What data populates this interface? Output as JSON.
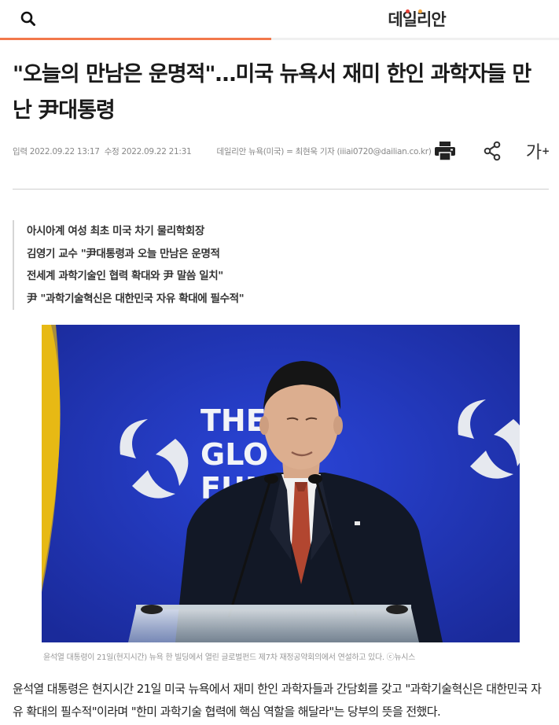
{
  "header": {
    "logo_text": "데일리안",
    "search_icon": "search-icon",
    "reading_progress": 0.485,
    "accent_color": "#f2784b"
  },
  "article": {
    "headline": "\"오늘의 만남은 운명적\"…미국 뉴욕서 재미 한인 과학자들 만난 尹대통령",
    "meta": {
      "published_label": "입력 2022.09.22 13:17",
      "modified_label": "수정 2022.09.22 21:31",
      "byline": "데일리안 뉴욕(미국) = 최현욱 기자 (iiiai0720@dailian.co.kr)"
    },
    "tools": {
      "print_icon": "print-icon",
      "share_icon": "share-icon",
      "font_size_label": "가",
      "font_size_plus": "+"
    },
    "summary": [
      "아시아계 여성 최초 미국 차기 물리학회장",
      "김영기 교수 \"尹대통령과 오늘 만남은 운명적",
      "전세계 과학기술인 협력 확대와 尹 말씀 일치\"",
      "尹 \"과학기술혁신은 대한민국 자유 확대에 필수적\""
    ],
    "photo": {
      "backdrop_text_line1": "THE",
      "backdrop_text_line2": "GLO",
      "backdrop_text_line3": "FUND",
      "backdrop_color": "#2337b5",
      "caption": "윤석열 대통령이 21일(현지시간) 뉴욕 한 빌딩에서 열린 글로벌펀드 제7차 재정공약회의에서 연설하고 있다. ⓒ뉴시스"
    },
    "body_paragraph": "윤석열 대통령은 현지시간 21일 미국 뉴욕에서 재미 한인 과학자들과 간담회를 갖고 \"과학기술혁신은 대한민국 자유 확대의 필수적\"이라며 \"한미 과학기술 협력에 핵심 역할을 해달라\"는 당부의 뜻을 전했다."
  }
}
